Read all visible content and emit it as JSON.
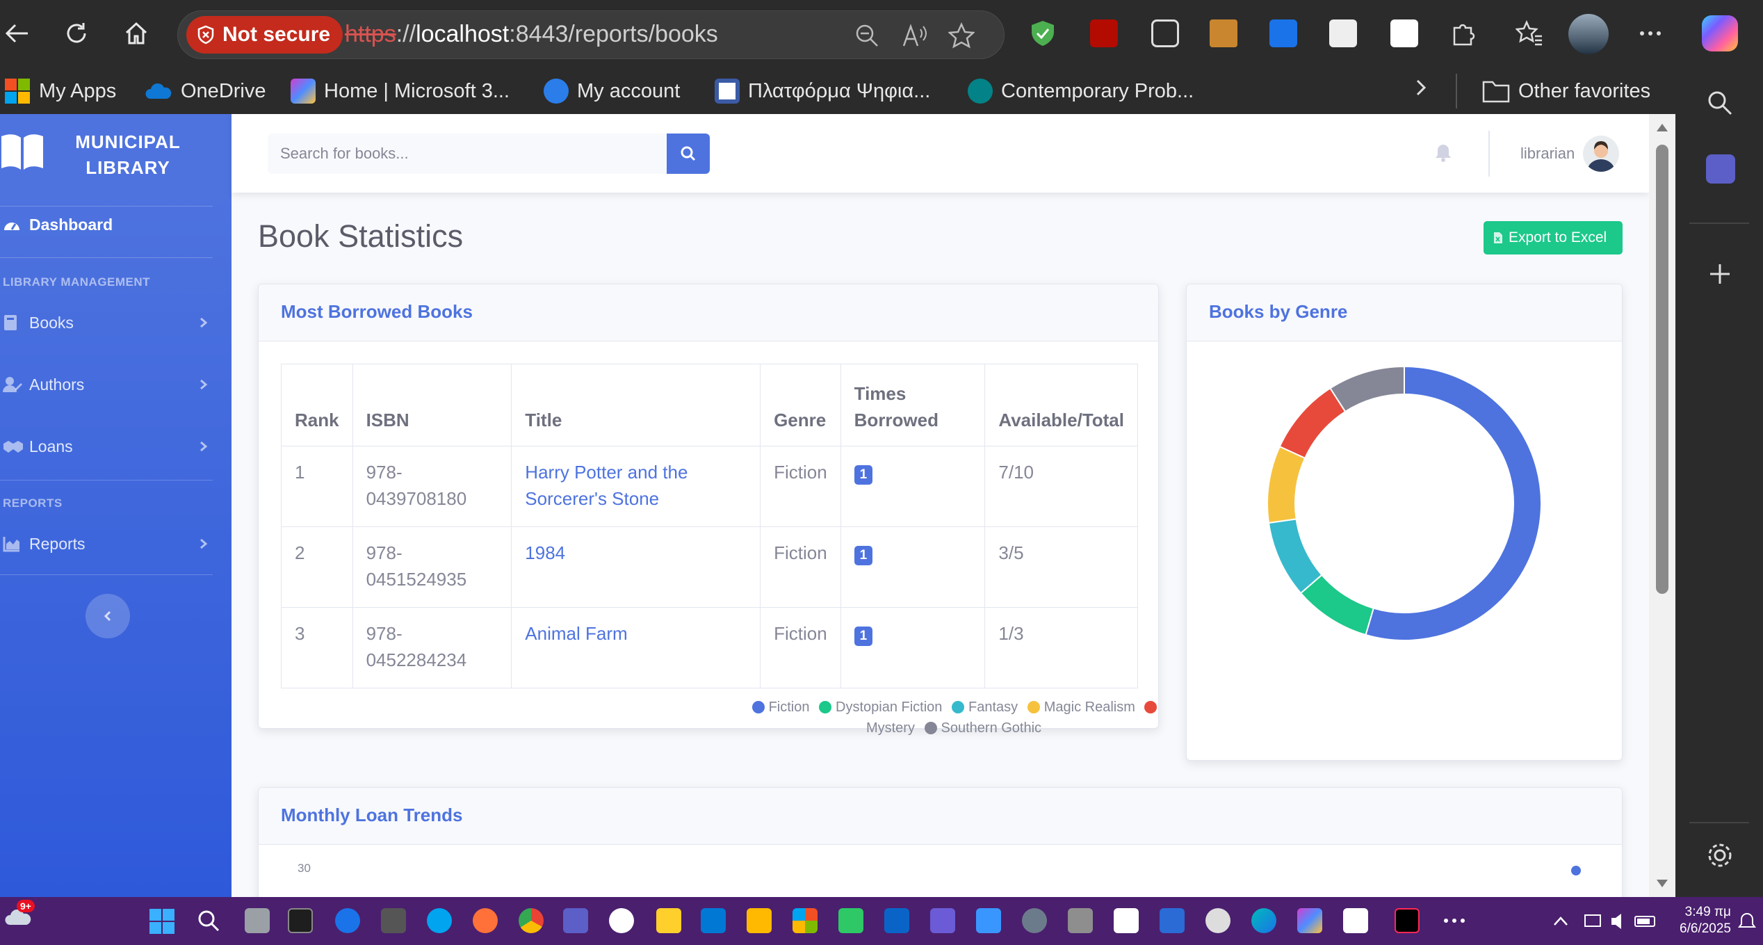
{
  "browser": {
    "security_label": "Not secure",
    "url_proto": "https",
    "url_host": "localhost",
    "url_rest": ":8443/reports/books",
    "favorites": [
      {
        "label": "My Apps",
        "color": "#f25022"
      },
      {
        "label": "OneDrive",
        "color": "#0f78d4"
      },
      {
        "label": "Home | Microsoft 3...",
        "color": "#d13fd0"
      },
      {
        "label": "My account",
        "color": "#2b7de9"
      },
      {
        "label": "Πλατφόρμα Ψηφια...",
        "color": "#3b5ba5"
      },
      {
        "label": "Contemporary Prob...",
        "color": "#038387"
      }
    ],
    "other_favorites": "Other favorites"
  },
  "sidebar": {
    "brand_line1": "MUNICIPAL",
    "brand_line2": "LIBRARY",
    "dashboard": "Dashboard",
    "heading_management": "LIBRARY MANAGEMENT",
    "books": "Books",
    "authors": "Authors",
    "loans": "Loans",
    "heading_reports": "REPORTS",
    "reports": "Reports"
  },
  "topbar": {
    "search_placeholder": "Search for books...",
    "username": "librarian"
  },
  "page": {
    "title": "Book Statistics",
    "export_label": "Export to Excel"
  },
  "most_borrowed": {
    "title": "Most Borrowed Books",
    "columns": [
      "Rank",
      "ISBN",
      "Title",
      "Genre",
      "Times Borrowed",
      "Available/Total"
    ],
    "rows": [
      {
        "rank": "1",
        "isbn": "978-0439708180",
        "title": "Harry Potter and the Sorcerer's Stone",
        "genre": "Fiction",
        "times": "1",
        "avail": "7/10"
      },
      {
        "rank": "2",
        "isbn": "978-0451524935",
        "title": "1984",
        "genre": "Fiction",
        "times": "1",
        "avail": "3/5"
      },
      {
        "rank": "3",
        "isbn": "978-0452284234",
        "title": "Animal Farm",
        "genre": "Fiction",
        "times": "1",
        "avail": "1/3"
      }
    ]
  },
  "genre_card": {
    "title": "Books by Genre"
  },
  "chart_data": {
    "type": "pie",
    "categories": [
      "Fiction",
      "Dystopian Fiction",
      "Fantasy",
      "Magic Realism",
      "Mystery",
      "Southern Gothic"
    ],
    "values": [
      6,
      1,
      1,
      1,
      1,
      1
    ],
    "colors": [
      "#4e73df",
      "#1cc88a",
      "#36b9cc",
      "#f6c23e",
      "#e74a3b",
      "#858796"
    ],
    "legend": "bottom"
  },
  "trends": {
    "title": "Monthly Loan Trends",
    "first_tick": "30"
  },
  "taskbar": {
    "time": "3:49 πμ",
    "date": "6/6/2025",
    "weather_badge": "9+"
  }
}
